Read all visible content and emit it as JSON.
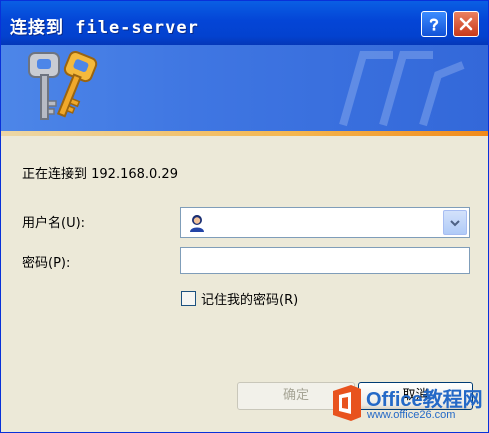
{
  "window": {
    "title": "连接到 file-server"
  },
  "dialog": {
    "connecting_text": "正在连接到 192.168.0.29",
    "username_label": "用户名(U):",
    "username_value": "",
    "password_label": "密码(P):",
    "password_value": "",
    "remember_label": "记住我的密码(R)",
    "remember_checked": false
  },
  "buttons": {
    "ok": "确定",
    "cancel": "取消"
  },
  "watermark": {
    "brand": "Office教程网",
    "url": "www.office26.com"
  },
  "colors": {
    "titlebar": "#0445d6",
    "banner": "#3f76e2",
    "accent_stripe": "#f4b64e",
    "watermark": "#2469c7"
  }
}
